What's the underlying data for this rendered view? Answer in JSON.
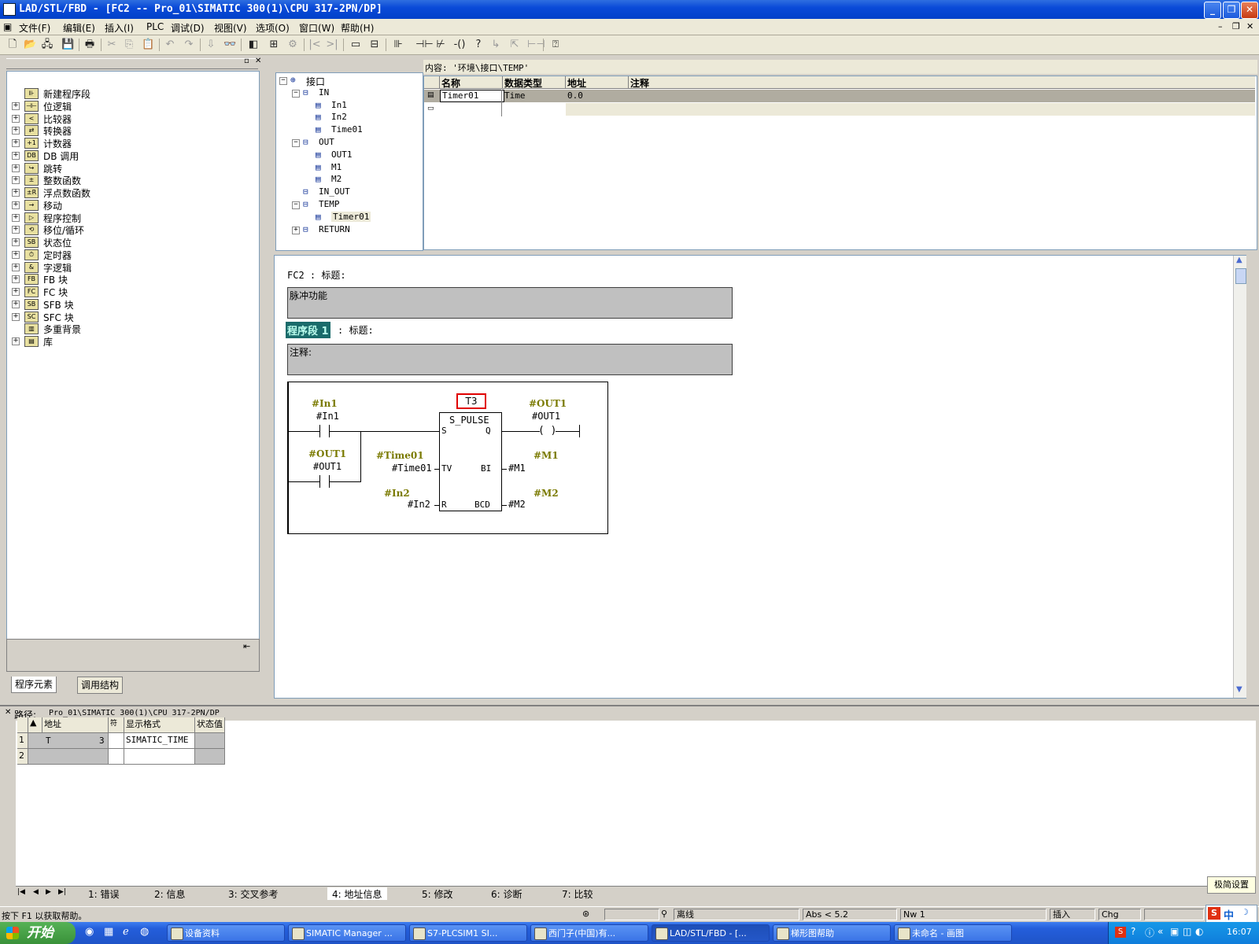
{
  "window": {
    "title": "LAD/STL/FBD  - [FC2 -- Pro_01\\SIMATIC 300(1)\\CPU 317-2PN/DP]"
  },
  "menu": [
    "文件(F)",
    "编辑(E)",
    "插入(I)",
    "PLC",
    "调试(D)",
    "视图(V)",
    "选项(O)",
    "窗口(W)",
    "帮助(H)"
  ],
  "left_tree": [
    {
      "label": "新建程序段",
      "expand": false,
      "icon": "new-network"
    },
    {
      "label": "位逻辑",
      "expand": true,
      "icon": "bit-logic"
    },
    {
      "label": "比较器",
      "expand": true,
      "icon": "comparator"
    },
    {
      "label": "转换器",
      "expand": true,
      "icon": "converter"
    },
    {
      "label": "计数器",
      "expand": true,
      "icon": "counter"
    },
    {
      "label": "DB 调用",
      "expand": true,
      "icon": "db-call"
    },
    {
      "label": "跳转",
      "expand": true,
      "icon": "jump"
    },
    {
      "label": "整数函数",
      "expand": true,
      "icon": "integer-math"
    },
    {
      "label": "浮点数函数",
      "expand": true,
      "icon": "float-math"
    },
    {
      "label": "移动",
      "expand": true,
      "icon": "move"
    },
    {
      "label": "程序控制",
      "expand": true,
      "icon": "program-control"
    },
    {
      "label": "移位/循环",
      "expand": true,
      "icon": "shift-rotate"
    },
    {
      "label": "状态位",
      "expand": true,
      "icon": "status-bits"
    },
    {
      "label": "定时器",
      "expand": true,
      "icon": "timer"
    },
    {
      "label": "字逻辑",
      "expand": true,
      "icon": "word-logic"
    },
    {
      "label": "FB 块",
      "expand": true,
      "icon": "fb-block"
    },
    {
      "label": "FC 块",
      "expand": true,
      "icon": "fc-block"
    },
    {
      "label": "SFB 块",
      "expand": true,
      "icon": "sfb-block"
    },
    {
      "label": "SFC 块",
      "expand": true,
      "icon": "sfc-block"
    },
    {
      "label": "多重背景",
      "expand": false,
      "icon": "multi-instance"
    },
    {
      "label": "库",
      "expand": true,
      "icon": "library"
    }
  ],
  "left_tabs": [
    "程序元素",
    "调用结构"
  ],
  "interface_tree": [
    {
      "label": "接口",
      "level": 0,
      "expand": "minus"
    },
    {
      "label": "IN",
      "level": 1,
      "expand": "minus"
    },
    {
      "label": "In1",
      "level": 2
    },
    {
      "label": "In2",
      "level": 2
    },
    {
      "label": "Time01",
      "level": 2
    },
    {
      "label": "OUT",
      "level": 1,
      "expand": "minus"
    },
    {
      "label": "OUT1",
      "level": 2
    },
    {
      "label": "M1",
      "level": 2
    },
    {
      "label": "M2",
      "level": 2
    },
    {
      "label": "IN_OUT",
      "level": 1
    },
    {
      "label": "TEMP",
      "level": 1,
      "expand": "minus"
    },
    {
      "label": "Timer01",
      "level": 2
    },
    {
      "label": "RETURN",
      "level": 1,
      "expand": "plus"
    }
  ],
  "interface_table": {
    "content_label": "内容:  '环境\\接口\\TEMP'",
    "headers": [
      "名称",
      "数据类型",
      "地址",
      "注释"
    ],
    "rows": [
      {
        "name": "Timer01",
        "type": "Time",
        "address": "0.0",
        "comment": ""
      }
    ]
  },
  "editor": {
    "block_title": "FC2 : 标题:",
    "block_comment": "脉冲功能",
    "network_label": "程序段 1",
    "network_title": ": 标题:",
    "network_comment": "注释:",
    "ladder": {
      "contact1_symbol": "#In1",
      "contact1_operand": "#In1",
      "contact2_symbol": "#OUT1",
      "contact2_operand": "#OUT1",
      "timer_address": "T3",
      "timer_type": "S_PULSE",
      "pin_s": "S",
      "pin_q": "Q",
      "pin_tv": "TV",
      "pin_bi": "BI",
      "pin_r": "R",
      "pin_bcd": "BCD",
      "tv_symbol": "#Time01",
      "tv_operand": "#Time01",
      "r_symbol": "#In2",
      "r_operand": "#In2",
      "coil_symbol": "#OUT1",
      "coil_operand": "#OUT1",
      "coil_glyph": "( )",
      "bi_symbol": "#M1",
      "bi_operand": "#M1",
      "bcd_symbol": "#M2",
      "bcd_operand": "#M2"
    }
  },
  "bottom": {
    "path_label": "路径:",
    "path_value": "Pro_01\\SIMATIC 300(1)\\CPU 317-2PN/DP",
    "grid_headers": [
      "地址",
      "符",
      "显示格式",
      "状态值"
    ],
    "grid_rows": [
      {
        "row": "1",
        "address": "T",
        "number": "3",
        "format": "SIMATIC_TIME",
        "value": ""
      },
      {
        "row": "2",
        "address": "",
        "number": "",
        "format": "",
        "value": ""
      }
    ],
    "tabs": [
      "1: 错误",
      "2: 信息",
      "3: 交叉参考",
      "4: 地址信息",
      "5: 修改",
      "6: 诊断",
      "7: 比较"
    ],
    "active_tab": "4: 地址信息"
  },
  "statusbar": {
    "help": "按下 F1 以获取帮助。",
    "mode": "离线",
    "abs": "Abs < 5.2",
    "nw": "Nw 1",
    "insert": "插入",
    "chg": "Chg",
    "tooltip": "极简设置"
  },
  "taskbar": {
    "start": "开始",
    "tasks": [
      "设备资料",
      "SIMATIC Manager ...",
      "S7-PLCSIM1    SI...",
      "西门子(中国)有...",
      "LAD/STL/FBD  - [...",
      "梯形图帮助",
      "未命名 - 画图"
    ],
    "active_task": "LAD/STL/FBD  - [...",
    "clock": "16:07",
    "ime_lang": "中"
  },
  "colors": {
    "titlebar": "#0a4ad8",
    "network_highlight": "#1a6b6b",
    "symbol_olive": "#7a7a00",
    "timer_box_border": "#e00000",
    "taskbar": "#245edb"
  }
}
